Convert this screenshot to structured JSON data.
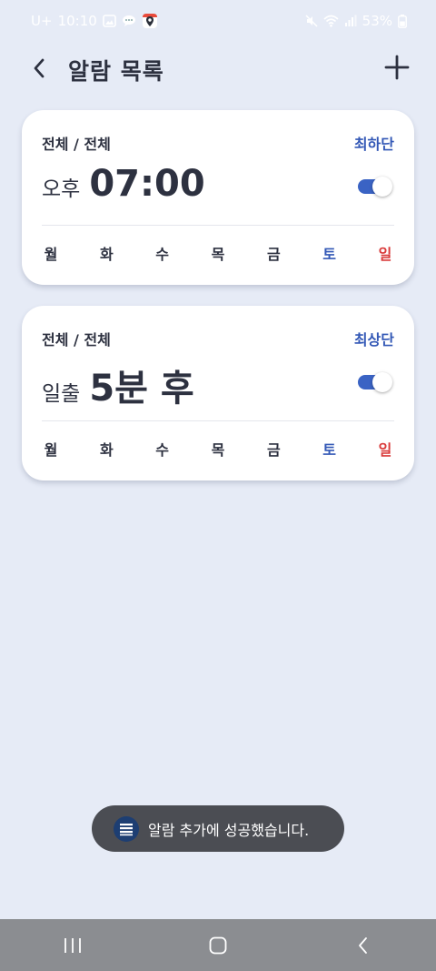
{
  "status_bar": {
    "carrier": "U+",
    "time": "10:10",
    "battery_percent": "53%",
    "left_icons": [
      "gallery-icon",
      "chat-bubble-icon",
      "map-pin-app-icon"
    ],
    "right_icons": [
      "mute-icon",
      "wifi-icon",
      "signal-icon",
      "battery-icon"
    ]
  },
  "header": {
    "title": "알람 목록",
    "back_icon": "chevron-left-icon",
    "add_icon": "plus-icon"
  },
  "alarms": [
    {
      "range": "전체 / 전체",
      "position": "최하단",
      "time_prefix": "오후",
      "time_main": "07:00",
      "enabled": true,
      "weekdays": [
        "월",
        "화",
        "수",
        "목",
        "금",
        "토",
        "일"
      ]
    },
    {
      "range": "전체 / 전체",
      "position": "최상단",
      "time_prefix": "일출",
      "time_main": "5분 후",
      "enabled": true,
      "weekdays": [
        "월",
        "화",
        "수",
        "목",
        "금",
        "토",
        "일"
      ]
    }
  ],
  "toast": {
    "message": "알람 추가에 성공했습니다.",
    "icon": "list-app-icon"
  },
  "nav_bar": {
    "icons": [
      "recent-apps-icon",
      "home-icon",
      "back-icon"
    ]
  },
  "colors": {
    "background": "#e6ebf6",
    "accent_blue": "#3358b6",
    "toggle_on": "#3a63c4",
    "sunday_red": "#d93a3a",
    "text_dark": "#2d3140",
    "toast_bg": "#4b4d53",
    "nav_bar_bg": "#8b8d91"
  }
}
